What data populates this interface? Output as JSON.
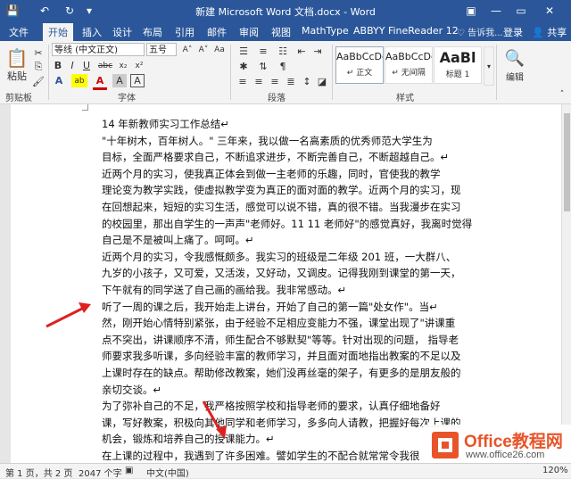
{
  "window": {
    "title": "新建 Microsoft Word 文档.docx - Word",
    "minimize": "—",
    "restore": "▭",
    "close": "✕",
    "ribbon_display": "▣"
  },
  "quick_access": {
    "save": "💾",
    "undo": "↶",
    "redo": "↻",
    "customize": "▾"
  },
  "tabs": [
    "文件",
    "开始",
    "插入",
    "设计",
    "布局",
    "引用",
    "邮件",
    "审阅",
    "视图",
    "MathType",
    "ABBYY FineReader 12"
  ],
  "active_tab": "开始",
  "tell_me": "♡ 告诉我...",
  "login": "登录",
  "share": "👤 共享",
  "ribbon": {
    "clipboard": {
      "label": "剪贴板",
      "paste": "粘贴",
      "cut": "✂",
      "copy": "⎘",
      "format_painter": "🖌"
    },
    "font": {
      "label": "字体",
      "font_name": "等线 (中文正文)",
      "font_size": "五号",
      "grow": "A˄",
      "shrink": "A˅",
      "clear": "Aa",
      "bold": "B",
      "italic": "I",
      "underline": "U",
      "strike": "abc",
      "subscript": "x₂",
      "superscript": "x²",
      "effects": "A",
      "highlight": "ab",
      "color": "A",
      "char_shading": "A",
      "char_border": "A"
    },
    "paragraph": {
      "label": "段落"
    },
    "styles": {
      "label": "样式",
      "items": [
        {
          "sample": "AaBbCcDd",
          "name": "↵ 正文"
        },
        {
          "sample": "AaBbCcDd",
          "name": "↵ 无间隔"
        },
        {
          "sample": "AaBl",
          "name": "标题 1"
        }
      ]
    },
    "editing": {
      "label": "编辑"
    }
  },
  "document": {
    "lines": [
      "14 年新教师实习工作总结↵",
      "\"十年树木，百年树人。\" 三年来，我以做一名高素质的优秀师范大学生为",
      "目标，全面严格要求自己，不断追求进步，不断完善自己，不断超越自己。↵",
      "近两个月的实习，使我真正体会到做一主老师的乐趣，同时，官使我的教学",
      "理论变为教学实践，使虚拟教学变为真正的面对面的教学。近两个月的实习，现",
      "在回想起来，短短的实习生活，感觉可以说不错，真的很不错。当我漫步在实习",
      "的校园里，那出自学生的一声声\"老师好。11 11 老师好\"的感觉真好，我离时觉得",
      "自己是不是被叫上痛了。呵呵。↵",
      "近两个月的实习，令我感慨颇多。我实习的班级是二年级 201 班，一大群八、",
      "九岁的小孩子，又可爱，又活泼，又好动，又调皮。记得我刚到课堂的第一天，",
      "下午就有的同学送了自己画的画给我。我非常感动。↵",
      "听了一周的课之后，我开始走上讲台，开始了自己的第一篇\"处女作\"。当↵",
      "然，刚开始心情特别紧张，由于经验不足相应变能力不强，课堂出现了\"讲课重",
      "点不突出，讲课顺序不清，师生配合不够默契\"等等。针对出现的问题，  指导老",
      "师要求我多听课，多向经验丰富的教师学习，并且面对面地指出教案的不足以及",
      "上课时存在的缺点。帮助修改教案，她们没再丝毫的架子，有更多的是朋友般的",
      "亲切交谈。↵",
      "为了弥补自己的不足，我严格按照学校和指导老师的要求，认真仔细地备好",
      "课，写好教案，积极向其他同学和老师学习，多多向人请教，把握好每次上课的",
      "机会，锻炼和培养自己的授课能力。↵",
      "在上课的过程中，我遇到了许多困难。譬如学生的不配合就常常令我很"
    ]
  },
  "status": {
    "page": "第 1 页，共 2 页",
    "words": "2047 个字",
    "lang_icon": "▣",
    "lang": "中文(中国)",
    "zoom": "120%"
  },
  "watermark": {
    "site": "Office教程网",
    "url": "www.office26.com"
  },
  "colors": {
    "title_bg": "#2b579a",
    "ribbon_bg": "#f3f3f3",
    "arrow": "#e02020",
    "logo_orange": "#e8542a"
  }
}
